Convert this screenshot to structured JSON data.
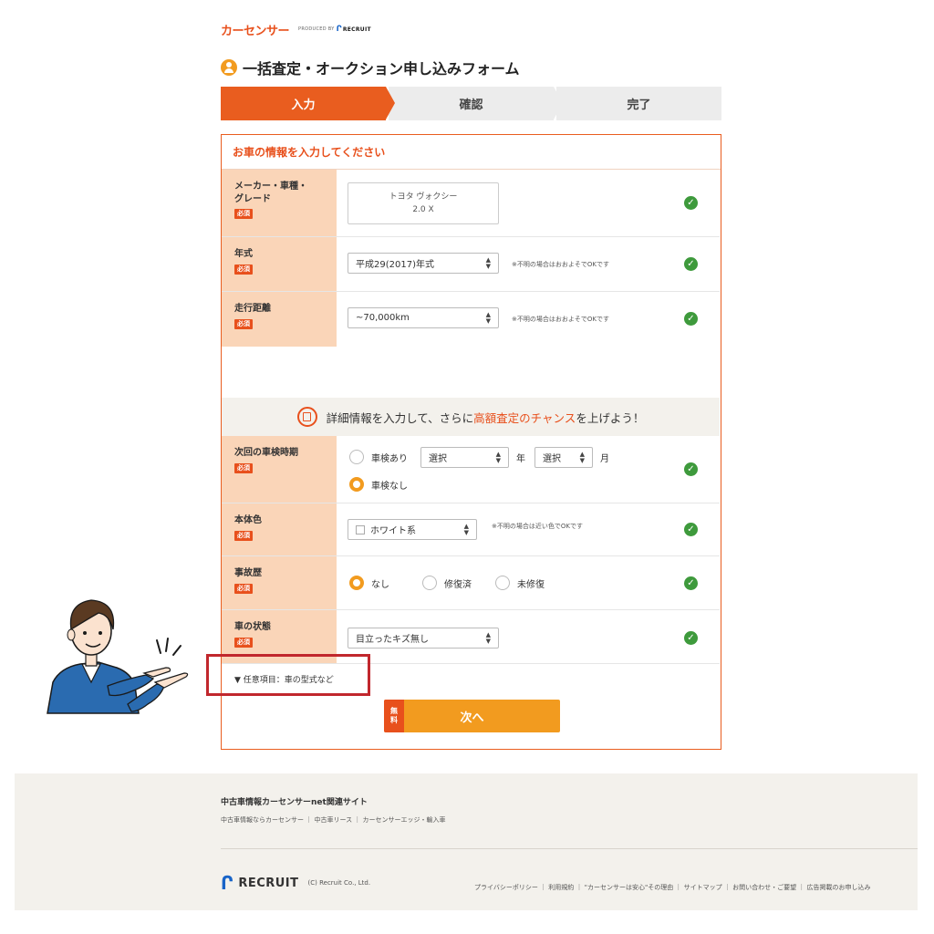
{
  "brand": {
    "logo": "カーセンサー",
    "produced_by": "PRODUCED BY",
    "recruit_mini": "RECRUIT"
  },
  "page_title": "一括査定・オークション申し込みフォーム",
  "steps": [
    "入力",
    "確認",
    "完了"
  ],
  "form": {
    "heading": "お車の情報を入力してください",
    "required_badge": "必須",
    "maker": {
      "label": "メーカー・車種・グレード",
      "label_line1": "メーカー・車種・",
      "label_line2": "グレード",
      "value_line1": "トヨタ ヴォクシー",
      "value_line2": "2.0 X"
    },
    "year": {
      "label": "年式",
      "value": "平成29(2017)年式",
      "note": "※不明の場合はおおよそでOKです"
    },
    "mileage": {
      "label": "走行距離",
      "value": "~70,000km",
      "note": "※不明の場合はおおよそでOKです"
    },
    "detail_band": {
      "prefix": "詳細情報を入力して、さらに",
      "highlight": "高額査定のチャンス",
      "suffix": "を上げよう！"
    },
    "inspection": {
      "label": "次回の車検時期",
      "option_yes": "車検あり",
      "year_select": "選択",
      "year_unit": "年",
      "month_select": "選択",
      "month_unit": "月",
      "option_no": "車検なし",
      "selected": "車検なし"
    },
    "color": {
      "label": "本体色",
      "value": "ホワイト系",
      "note": "※不明の場合は近い色でOKです"
    },
    "accident": {
      "label": "事故歴",
      "options": [
        "なし",
        "修復済",
        "未修復"
      ],
      "selected": "なし"
    },
    "condition": {
      "label": "車の状態",
      "value": "目立ったキズ無し"
    },
    "optional_toggle": "▼ 任意項目：車の型式など",
    "next_button": {
      "free_line1": "無",
      "free_line2": "料",
      "label": "次へ"
    }
  },
  "footer": {
    "title": "中古車情報カーセンサーnet関連サイト",
    "links": "中古車情報ならカーセンサー ｜ 中古車リース ｜ カーセンサーエッジ・輸入車",
    "brand": "RECRUIT",
    "copyright": "(C) Recruit Co., Ltd.",
    "nav": "プライバシーポリシー ｜ 利用規約 ｜ \"カーセンサーは安心\"その理由 ｜ サイトマップ ｜ お問い合わせ・ご要望 ｜ 広告掲載のお申し込み"
  },
  "colors": {
    "accent": "#e95d1f",
    "orange": "#f29b1f",
    "label_bg": "#fad5b8",
    "check": "#3e9a3c",
    "highlight_box": "#c1272d"
  },
  "icons": [
    "user-icon",
    "check-icon",
    "document-icon",
    "chevron-down-icon",
    "recruit-logo-icon"
  ]
}
